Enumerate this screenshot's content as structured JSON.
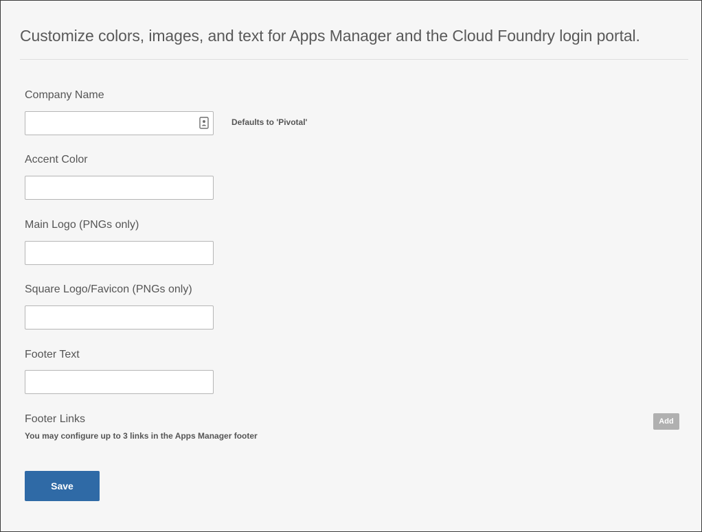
{
  "header": {
    "title": "Customize colors, images, and text for Apps Manager and the Cloud Foundry login portal."
  },
  "form": {
    "company_name": {
      "label": "Company Name",
      "value": "",
      "default_hint": "Defaults to 'Pivotal'",
      "icon": "contact-card-icon"
    },
    "accent_color": {
      "label": "Accent Color",
      "value": ""
    },
    "main_logo": {
      "label": "Main Logo (PNGs only)",
      "value": ""
    },
    "square_logo": {
      "label": "Square Logo/Favicon (PNGs only)",
      "value": ""
    },
    "footer_text": {
      "label": "Footer Text",
      "value": ""
    },
    "footer_links": {
      "label": "Footer Links",
      "description": "You may configure up to 3 links in the Apps Manager footer",
      "add_label": "Add"
    }
  },
  "actions": {
    "save_label": "Save"
  },
  "colors": {
    "background": "#f6f6f6",
    "primary_button": "#2f6aa6",
    "secondary_button": "#b0b0b0",
    "input_border": "#b5b5b5"
  }
}
